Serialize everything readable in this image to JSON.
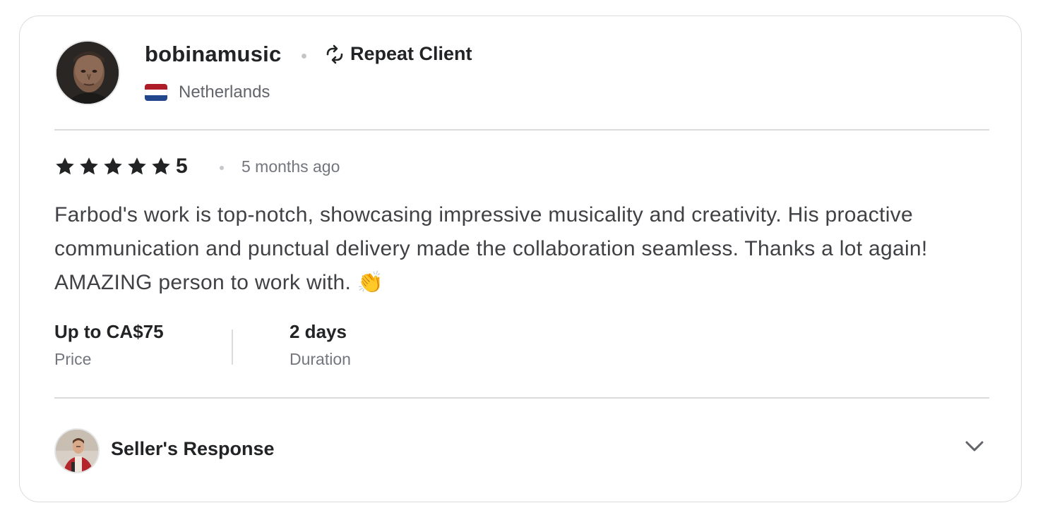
{
  "reviewer": {
    "username": "bobinamusic",
    "badge_label": "Repeat Client",
    "badge_icon": "repeat-icon",
    "country": "Netherlands",
    "flag_colors": [
      "#ae1c28",
      "#ffffff",
      "#21468b"
    ]
  },
  "review": {
    "rating": 5,
    "rating_label": "5",
    "stars_filled": 5,
    "time_ago": "5 months ago",
    "text": "Farbod's work is top-notch, showcasing impressive musicality and creativity. His proactive communication and punctual delivery made the collaboration seamless. Thanks a lot again! AMAZING person to work with. 👏"
  },
  "meta": {
    "price_value": "Up to CA$75",
    "price_label": "Price",
    "duration_value": "2 days",
    "duration_label": "Duration"
  },
  "seller_response": {
    "label": "Seller's Response",
    "toggle_icon": "chevron-down-icon"
  },
  "colors": {
    "text_primary": "#222325",
    "text_secondary": "#74767e",
    "border": "#dadbdd"
  }
}
